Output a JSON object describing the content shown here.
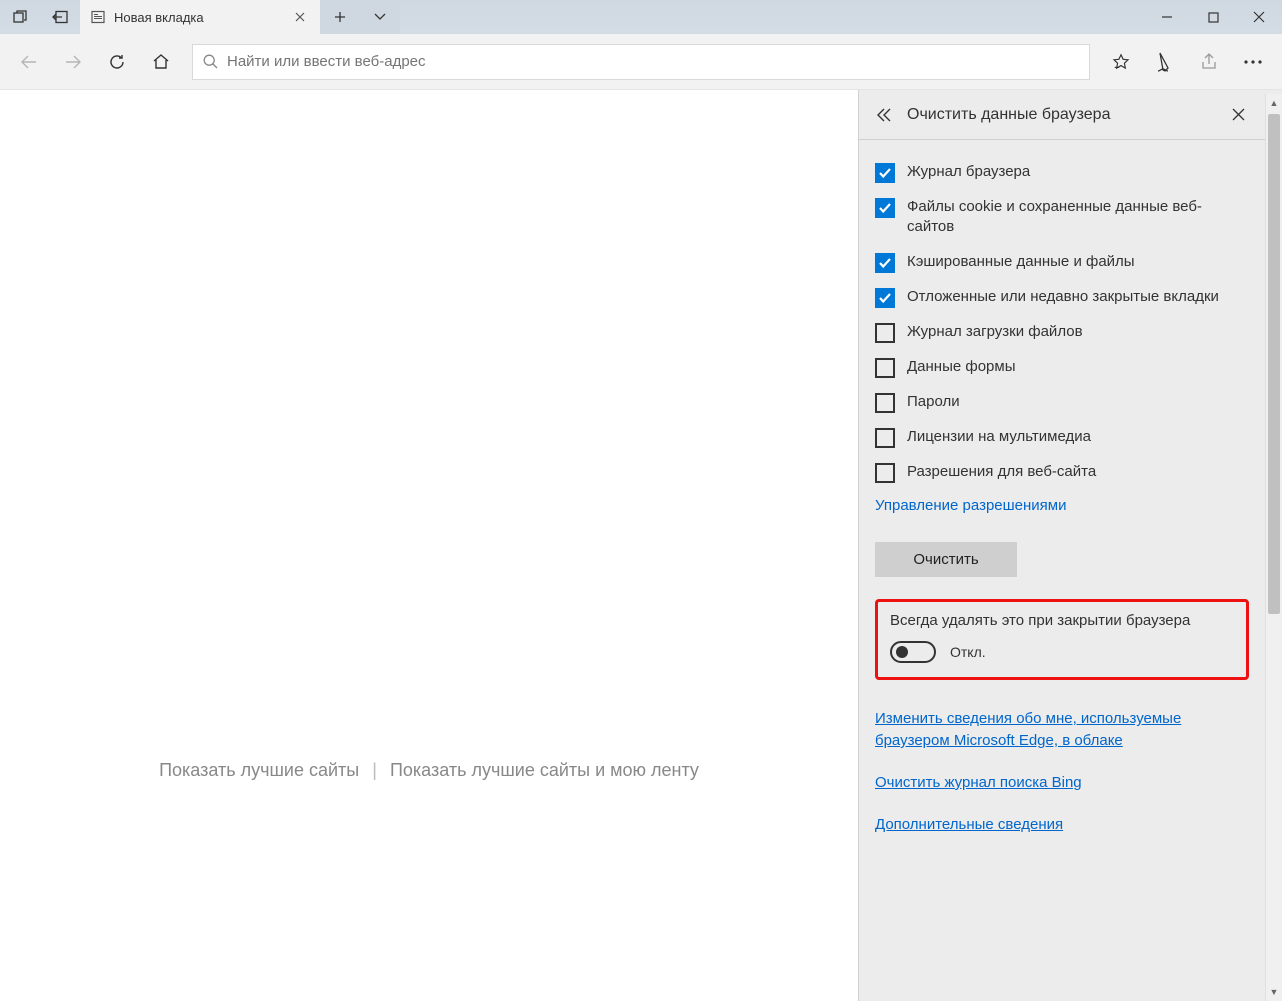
{
  "tab": {
    "title": "Новая вкладка"
  },
  "address": {
    "placeholder": "Найти или ввести веб-адрес"
  },
  "content": {
    "show_top_sites": "Показать лучшие сайты",
    "show_top_sites_and_feed": "Показать лучшие сайты и мою ленту"
  },
  "pane": {
    "title": "Очистить данные браузера",
    "items": [
      {
        "label": "Журнал браузера",
        "checked": true
      },
      {
        "label": "Файлы cookie и сохраненные данные веб-сайтов",
        "checked": true
      },
      {
        "label": "Кэшированные данные и файлы",
        "checked": true
      },
      {
        "label": "Отложенные или недавно закрытые вкладки",
        "checked": true
      },
      {
        "label": "Журнал загрузки файлов",
        "checked": false
      },
      {
        "label": "Данные формы",
        "checked": false
      },
      {
        "label": "Пароли",
        "checked": false
      },
      {
        "label": "Лицензии на мультимедиа",
        "checked": false
      },
      {
        "label": "Разрешения для веб-сайта",
        "checked": false
      }
    ],
    "manage_permissions": "Управление разрешениями",
    "clear_button": "Очистить",
    "always_clear_title": "Всегда удалять это при закрытии браузера",
    "toggle_state": "Откл.",
    "link_cloud": "Изменить сведения обо мне, используемые браузером Microsoft Edge, в облаке",
    "link_bing": "Очистить журнал поиска Bing",
    "link_more": "Дополнительные сведения"
  }
}
